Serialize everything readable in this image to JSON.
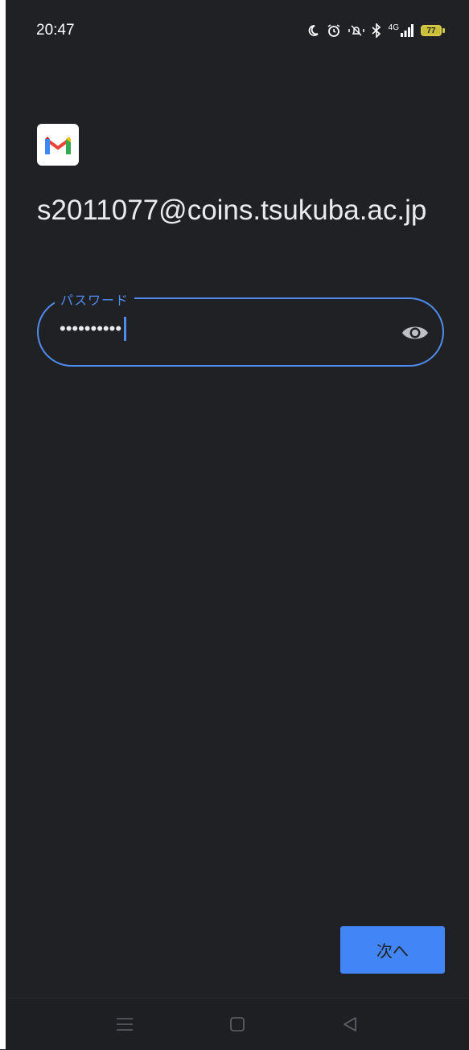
{
  "status_bar": {
    "time": "20:47",
    "network": "4G",
    "battery_level": "77",
    "icons": [
      "moon-icon",
      "alarm-icon",
      "vibrate-off-icon",
      "bluetooth-icon",
      "signal-icon",
      "battery-icon"
    ]
  },
  "app": {
    "logo": "gmail-logo",
    "account_email": "s2011077@coins.tsukuba.ac.jp"
  },
  "password_field": {
    "label": "パスワード",
    "value_masked": "••••••••••",
    "toggle_icon": "eye-icon"
  },
  "actions": {
    "next_label": "次へ"
  },
  "nav_bar": {
    "icons": [
      "menu-icon",
      "home-icon",
      "back-icon"
    ]
  },
  "colors": {
    "background": "#202124",
    "accent": "#4285f4",
    "field_border": "#4f8cf0"
  }
}
